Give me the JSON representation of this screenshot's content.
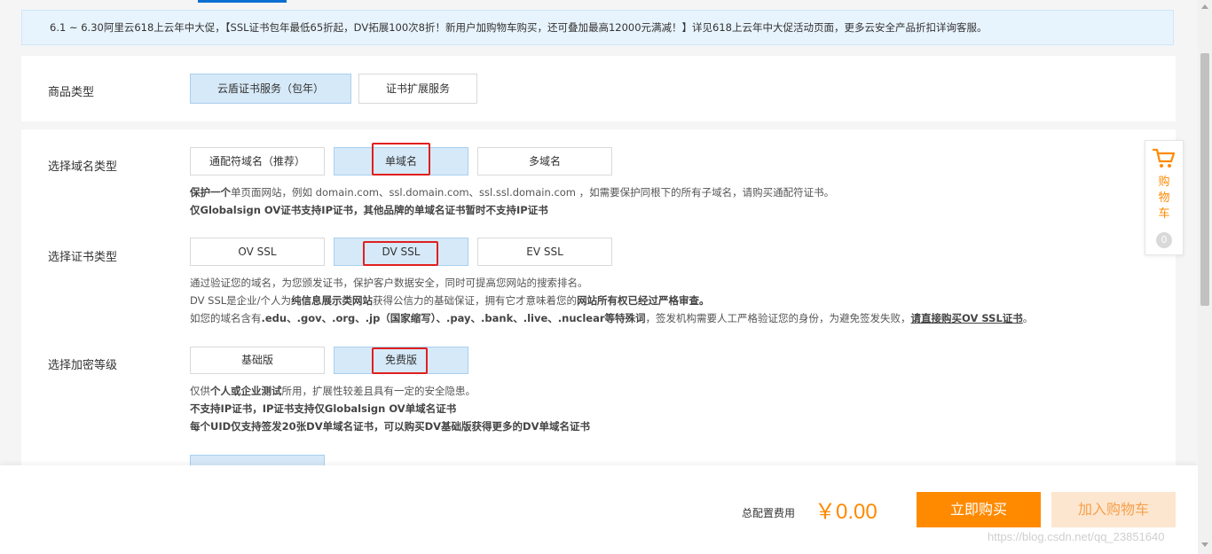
{
  "promo": {
    "text": "6.1 ~ 6.30阿里云618上云年中大促，【SSL证书包年最低65折起，DV拓展100次8折！新用户加购物车购买，还可叠加最高12000元满减！】详见618上云年中大促活动页面，更多云安全产品折扣详询客服。"
  },
  "product_type": {
    "label": "商品类型",
    "options": [
      "云盾证书服务（包年）",
      "证书扩展服务"
    ],
    "selected": "云盾证书服务（包年）"
  },
  "domain_type": {
    "label": "选择域名类型",
    "options": [
      "通配符域名（推荐）",
      "单域名",
      "多域名"
    ],
    "selected": "单域名",
    "desc1_bold": "保护一个",
    "desc1_rest": "单页面网站，例如 domain.com、ssl.domain.com、ssl.ssl.domain.com ，如需要保护同根下的所有子域名，请购买通配符证书。",
    "desc2": "仅Globalsign OV证书支持IP证书，其他品牌的单域名证书暂时不支持IP证书"
  },
  "cert_type": {
    "label": "选择证书类型",
    "options": [
      "OV SSL",
      "DV SSL",
      "EV SSL"
    ],
    "selected": "DV SSL",
    "desc1": "通过验证您的域名，为您颁发证书，保护客户数据安全，同时可提高您网站的搜索排名。",
    "desc2_a": "DV SSL是企业/个人为",
    "desc2_b": "纯信息展示类网站",
    "desc2_c": "获得公信力的基础保证，拥有它才意味着您的",
    "desc2_d": "网站所有权已经过严格审查。",
    "desc3_a": "如您的域名含有",
    "desc3_b": ".edu、.gov、.org、.jp（国家缩写）、.pay、.bank、.live、.nuclear等特殊词",
    "desc3_c": "，签发机构需要人工严格验证您的身份，为避免签发失败，",
    "desc3_link": "请直接购买OV SSL证书",
    "desc3_end": "。"
  },
  "encryption": {
    "label": "选择加密等级",
    "options": [
      "基础版",
      "免费版"
    ],
    "selected": "免费版",
    "desc1_a": "仅供",
    "desc1_b": "个人或企业测试",
    "desc1_c": "所用，扩展性较差且具有一定的安全隐患。",
    "desc2": "不支持IP证书，IP证书支持仅Globalsign OV单域名证书",
    "desc3": "每个UID仅支持签发20张DV单域名证书，可以购买DV基础版获得更多的DV单域名证书"
  },
  "footer": {
    "total_label": "总配置费用",
    "total_price": "￥0.00",
    "buy_now": "立即购买",
    "add_to_cart": "加入购物车",
    "watermark": "https://blog.csdn.net/qq_23851640"
  },
  "side_cart": {
    "label_chars": [
      "购",
      "物",
      "车"
    ],
    "count": "0"
  },
  "colors": {
    "accent_orange": "#ff8a00",
    "selected_bg": "#d6e9f8",
    "highlight_red": "#e01f1f",
    "promo_bg": "#e8f4fd"
  }
}
